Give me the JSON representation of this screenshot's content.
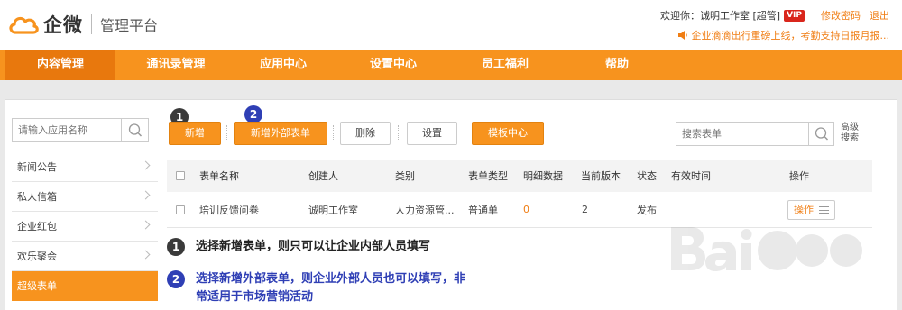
{
  "header": {
    "logo_text": "企微",
    "platform": "管理平台",
    "welcome": "欢迎你：诚明工作室 [超管]",
    "vip": "VIP",
    "change_password": "修改密码",
    "logout": "退出",
    "notice": "企业滴滴出行重磅上线，考勤支持日报月报..."
  },
  "nav": {
    "items": [
      {
        "label": "内容管理"
      },
      {
        "label": "通讯录管理"
      },
      {
        "label": "应用中心"
      },
      {
        "label": "设置中心"
      },
      {
        "label": "员工福利"
      },
      {
        "label": "帮助"
      }
    ]
  },
  "sidebar": {
    "search_placeholder": "请输入应用名称",
    "items": [
      {
        "label": "新闻公告"
      },
      {
        "label": "私人信箱"
      },
      {
        "label": "企业红包"
      },
      {
        "label": "欢乐聚会"
      },
      {
        "label": "超级表单"
      }
    ]
  },
  "toolbar": {
    "add": "新增",
    "add_external": "新增外部表单",
    "delete": "删除",
    "settings": "设置",
    "template_center": "模板中心",
    "search_placeholder": "搜索表单",
    "advanced_search": "高级搜索"
  },
  "badges": {
    "one": "1",
    "two": "2"
  },
  "table": {
    "headers": [
      "表单名称",
      "创建人",
      "类别",
      "表单类型",
      "明细数据",
      "当前版本",
      "状态",
      "有效时间",
      "操作"
    ],
    "rows": [
      {
        "name": "培训反馈问卷",
        "creator": "诚明工作室",
        "category": "人力资源管...",
        "type": "普通单",
        "detail": "0",
        "version": "2",
        "status": "发布",
        "valid": "",
        "action": "操作"
      }
    ]
  },
  "annotations": {
    "one": "选择新增表单，则只可以让企业内部人员填写",
    "two_line1": "选择新增外部表单，则企业外部人员也可以填写，非",
    "two_line2": "常适用于市场营销活动"
  },
  "colors": {
    "brand": "#f7931e",
    "nav_active": "#e8780d",
    "accent_blue": "#2f3fb5"
  }
}
